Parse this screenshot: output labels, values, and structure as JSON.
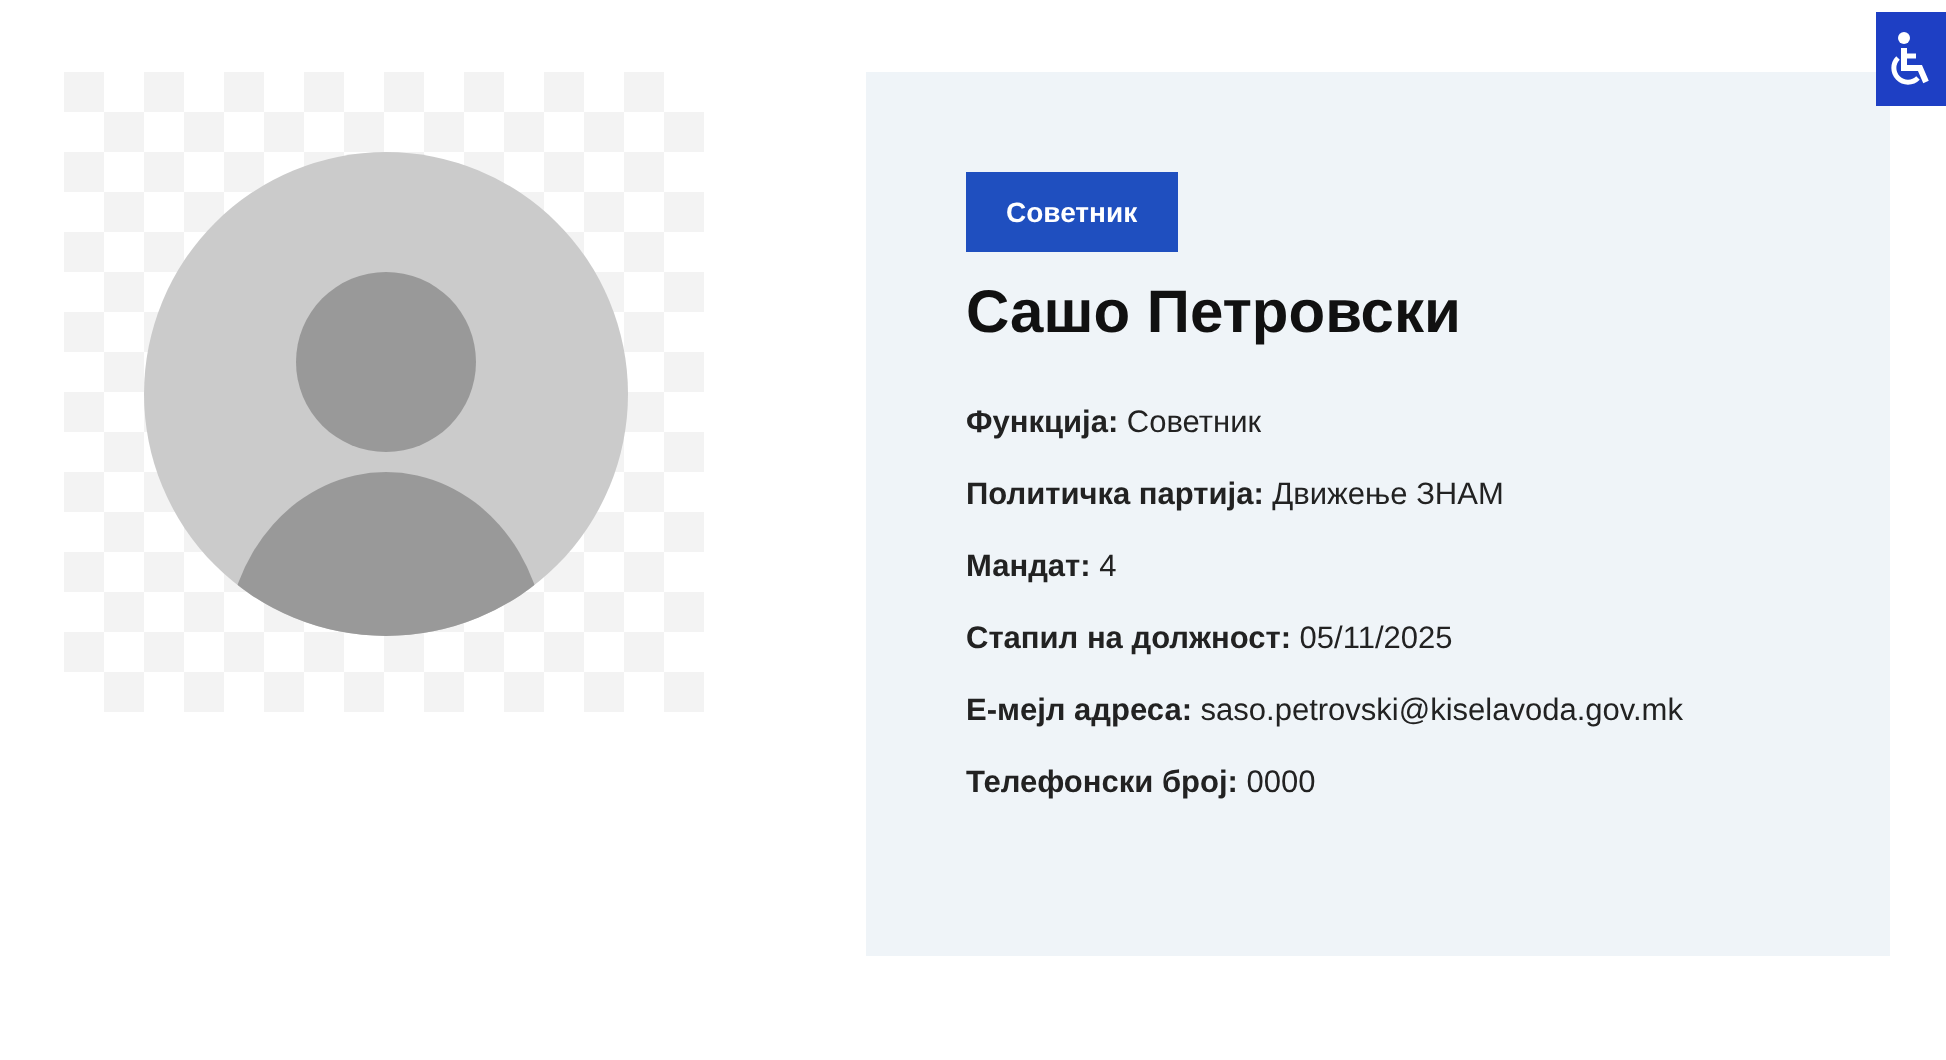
{
  "profile": {
    "badge": "Советник",
    "name": "Сашо Петровски",
    "detail_groups": [
      [
        "**Функција:** Советник",
        "**Политичка партија:** Движење ЗНАМ",
        "**Мандат:** 4",
        "**Стапил на должност:** 05/11/2025"
      ],
      [
        "**Е-мејл адреса:** saso.petrovski@kiselavoda.gov.mk",
        "**Телефонски број:** 0000"
      ]
    ]
  }
}
